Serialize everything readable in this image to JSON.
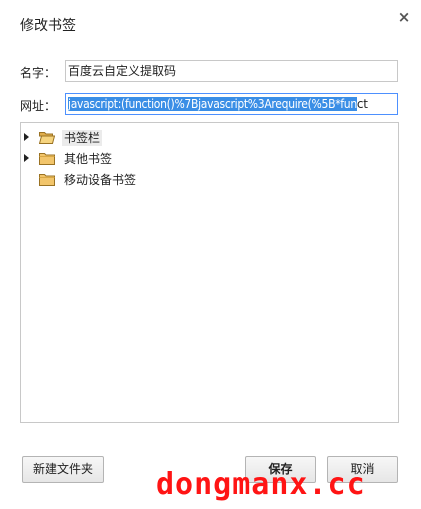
{
  "dialog": {
    "title": "修改书签",
    "close_glyph": "×"
  },
  "form": {
    "name_label": "名字：",
    "name_value": "百度云自定义提取码",
    "url_label": "网址：",
    "url_value_selected": "javascript:(function()%7Bjavascript%3Arequire(%5B*fun",
    "url_value_tail": "ct"
  },
  "tree": {
    "folders": [
      {
        "label": "书签栏",
        "expandable": true,
        "open": true,
        "highlighted": true
      },
      {
        "label": "其他书签",
        "expandable": true,
        "open": false,
        "highlighted": false
      },
      {
        "label": "移动设备书签",
        "expandable": false,
        "open": false,
        "highlighted": false
      }
    ]
  },
  "buttons": {
    "new_folder": "新建文件夹",
    "save": "保存",
    "cancel": "取消"
  },
  "watermark": "dongmanx.cc",
  "colors": {
    "selection": "#3a8ee6",
    "folder": "#f2c56b",
    "watermark": "#ff1414"
  }
}
